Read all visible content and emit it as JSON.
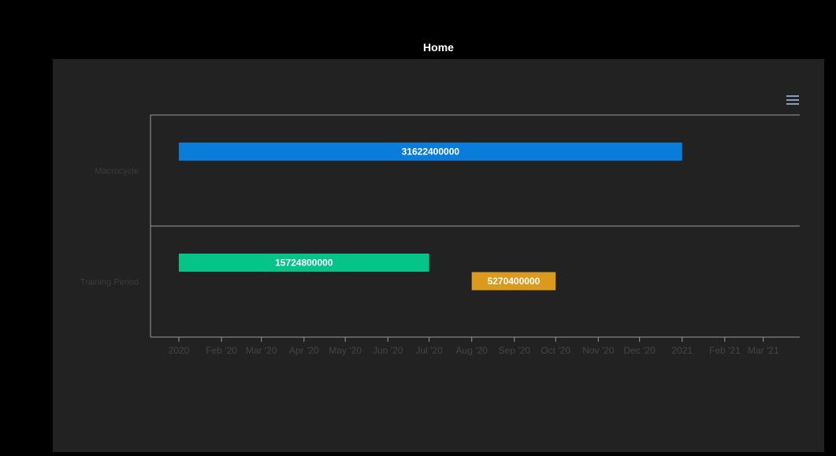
{
  "header": {
    "title": "Home"
  },
  "menu": {
    "icon": "hamburger-menu-icon"
  },
  "colors": {
    "background": "#000000",
    "panel": "#222222",
    "axis": "#9a9a9a",
    "macrocycle_bar": "#0a7ddb",
    "training_bar_1": "#05c488",
    "training_bar_2": "#dc9a1d"
  },
  "chart_data": {
    "type": "bar",
    "orientation": "horizontal-timeline",
    "title": "",
    "categories": [
      "Macrocycle",
      "Training Period"
    ],
    "x_ticks": [
      "2020",
      "Feb '20",
      "Mar '20",
      "Apr '20",
      "May '20",
      "Jun '20",
      "Jul '20",
      "Aug '20",
      "Sep '20",
      "Oct '20",
      "Nov '20",
      "Dec '20",
      "2021",
      "Feb '21",
      "Mar '21"
    ],
    "xlim": [
      "2020-01-01",
      "2021-03-31"
    ],
    "series": [
      {
        "category": "Macrocycle",
        "start": "2020-01-01",
        "end": "2021-01-01",
        "value": 31622400000,
        "label": "31622400000",
        "color": "#0a7ddb",
        "lane": 0
      },
      {
        "category": "Training Period",
        "start": "2020-01-01",
        "end": "2020-07-01",
        "value": 15724800000,
        "label": "15724800000",
        "color": "#05c488",
        "lane": 0
      },
      {
        "category": "Training Period",
        "start": "2020-08-01",
        "end": "2020-10-01",
        "value": 5270400000,
        "label": "5270400000",
        "color": "#dc9a1d",
        "lane": 1
      }
    ],
    "grid": false,
    "legend": "none"
  }
}
